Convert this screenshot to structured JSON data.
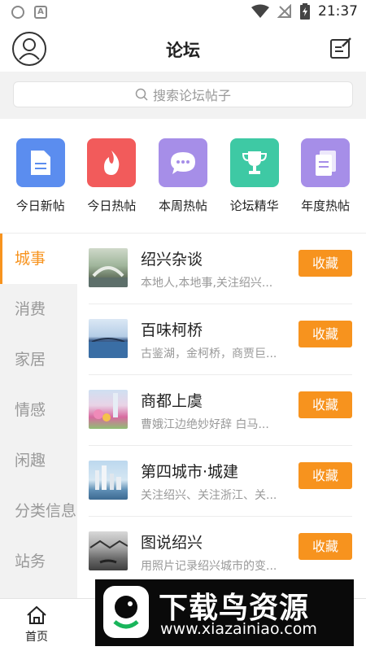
{
  "status_bar": {
    "time": "21:37"
  },
  "header": {
    "title": "论坛"
  },
  "search": {
    "placeholder": "搜索论坛帖子"
  },
  "categories": [
    {
      "label": "今日新帖",
      "icon": "document-icon",
      "color": "#5b8def"
    },
    {
      "label": "今日热帖",
      "icon": "flame-icon",
      "color": "#f25b5b"
    },
    {
      "label": "本周热帖",
      "icon": "chat-bubble-icon",
      "color": "#a68ee8"
    },
    {
      "label": "论坛精华",
      "icon": "trophy-icon",
      "color": "#3ec9a4"
    },
    {
      "label": "年度热帖",
      "icon": "documents-icon",
      "color": "#a68ee8"
    }
  ],
  "sidebar": {
    "items": [
      {
        "label": "城事",
        "active": true
      },
      {
        "label": "消费"
      },
      {
        "label": "家居"
      },
      {
        "label": "情感"
      },
      {
        "label": "闲趣"
      },
      {
        "label": "分类信息"
      },
      {
        "label": "站务"
      }
    ]
  },
  "forums": [
    {
      "title": "绍兴杂谈",
      "desc": "本地人,本地事,关注绍兴...",
      "button": "收藏"
    },
    {
      "title": "百味柯桥",
      "desc": "古鉴湖，金柯桥，商贾巨...",
      "button": "收藏"
    },
    {
      "title": "商都上虞",
      "desc": "曹娥江边绝妙好辞 白马...",
      "button": "收藏"
    },
    {
      "title": "第四城市·城建",
      "desc": "关注绍兴、关注浙江、关...",
      "button": "收藏"
    },
    {
      "title": "图说绍兴",
      "desc": "用照片记录绍兴城市的变...",
      "button": "收藏"
    }
  ],
  "tabbar": {
    "items": [
      {
        "label": "首页",
        "icon": "home-icon"
      },
      {
        "label": "",
        "icon": "tab-2-icon"
      },
      {
        "label": "",
        "icon": "tab-3-icon"
      },
      {
        "label": "",
        "icon": "tab-4-icon"
      },
      {
        "label": "",
        "icon": "tab-5-icon"
      }
    ]
  },
  "watermark": {
    "main": "下载鸟资源",
    "url": "www.xiazainiao.com"
  },
  "colors": {
    "accent": "#f7931e",
    "sidebar_bg": "#f2f2f2"
  }
}
